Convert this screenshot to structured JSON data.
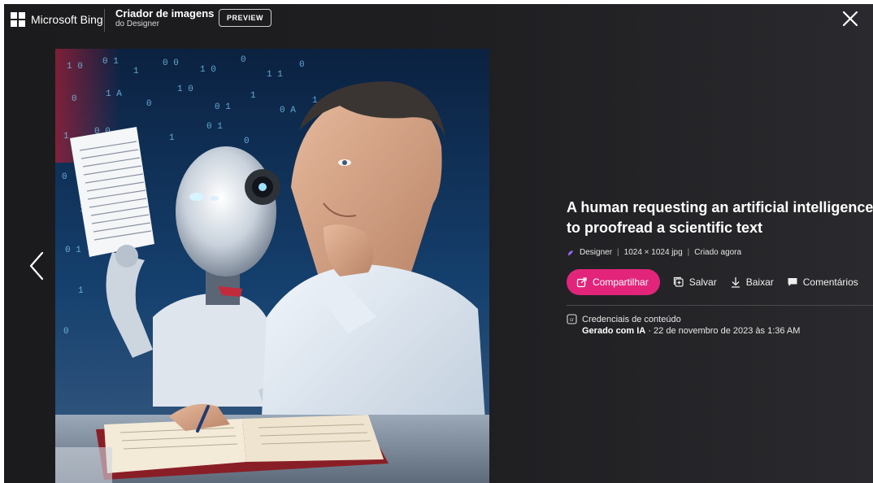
{
  "header": {
    "brand": "Microsoft Bing",
    "app_title": "Criador de imagens",
    "app_subtitle": "do Designer",
    "preview_badge": "PREVIEW"
  },
  "image_detail": {
    "title": "A human requesting an artificial intelligence to proofread a scientific text",
    "meta": {
      "source": "Designer",
      "separator": "|",
      "dimensions": "1024 × 1024 jpg",
      "created": "Criado agora"
    },
    "actions": {
      "share": "Compartilhar",
      "save": "Salvar",
      "download": "Baixar",
      "comments": "Comentários"
    },
    "credentials": {
      "label": "Credenciais de conteúdo",
      "generated": "Gerado com IA",
      "date": "· 22 de novembro de 2023 às 1:36 AM"
    }
  },
  "icons": {
    "close": "close-icon",
    "prev": "chevron-left-icon",
    "share": "share-icon",
    "save": "collection-add-icon",
    "download": "download-icon",
    "comments": "comment-icon",
    "credentials": "content-credentials-icon"
  },
  "colors": {
    "accent": "#e2257b",
    "background": "#1f1f22"
  }
}
